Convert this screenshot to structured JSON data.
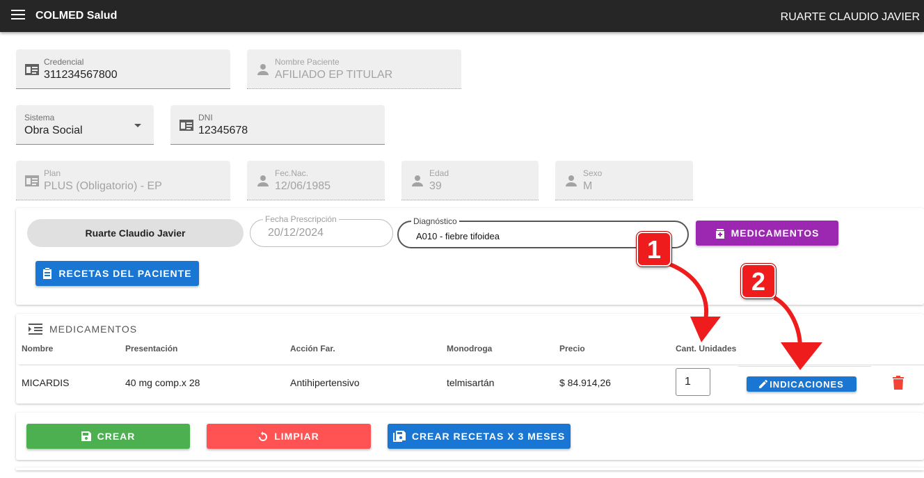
{
  "header": {
    "title": "COLMED Salud",
    "user": "RUARTE CLAUDIO JAVIER"
  },
  "patient": {
    "credencial": {
      "label": "Credencial",
      "value": "311234567800"
    },
    "nombre": {
      "label": "Nombre Paciente",
      "value": "AFILIADO EP TITULAR"
    },
    "sistema": {
      "label": "Sistema",
      "value": "Obra Social"
    },
    "dni": {
      "label": "DNI",
      "value": "12345678"
    },
    "plan": {
      "label": "Plan",
      "value": "PLUS (Obligatorio) - EP"
    },
    "fecnac": {
      "label": "Fec.Nac.",
      "value": "12/06/1985"
    },
    "edad": {
      "label": "Edad",
      "value": "39"
    },
    "sexo": {
      "label": "Sexo",
      "value": "M"
    }
  },
  "prescription": {
    "doctor": "Ruarte Claudio Javier",
    "fecha": {
      "label": "Fecha Prescripción",
      "value": "20/12/2024"
    },
    "diagnostico": {
      "label": "Diagnóstico",
      "value": "A010 - fiebre tifoidea"
    },
    "medicamentos_button": "MEDICAMENTOS",
    "recetas_button": "RECETAS DEL PACIENTE"
  },
  "meds": {
    "title": "MEDICAMENTOS",
    "columns": [
      "Nombre",
      "Presentación",
      "Acción Far.",
      "Monodroga",
      "Precio",
      "Cant. Unidades"
    ],
    "rows": [
      {
        "nombre": "MICARDIS",
        "presentacion": "40 mg comp.x 28",
        "accion": "Antihipertensivo",
        "monodroga": "telmisartán",
        "precio": "$ 84.914,26",
        "cantidad": "1",
        "indicaciones": "INDICACIONES"
      }
    ]
  },
  "actions": {
    "crear": "CREAR",
    "limpiar": "LIMPIAR",
    "crear3": "CREAR RECETAS X 3 MESES"
  },
  "annotations": {
    "badge1": "1",
    "badge2": "2"
  },
  "colors": {
    "purple": "#9c27b0",
    "blue": "#1976d2",
    "green": "#4caf50",
    "red": "#ff5252",
    "badge": "#ee1c1c"
  }
}
